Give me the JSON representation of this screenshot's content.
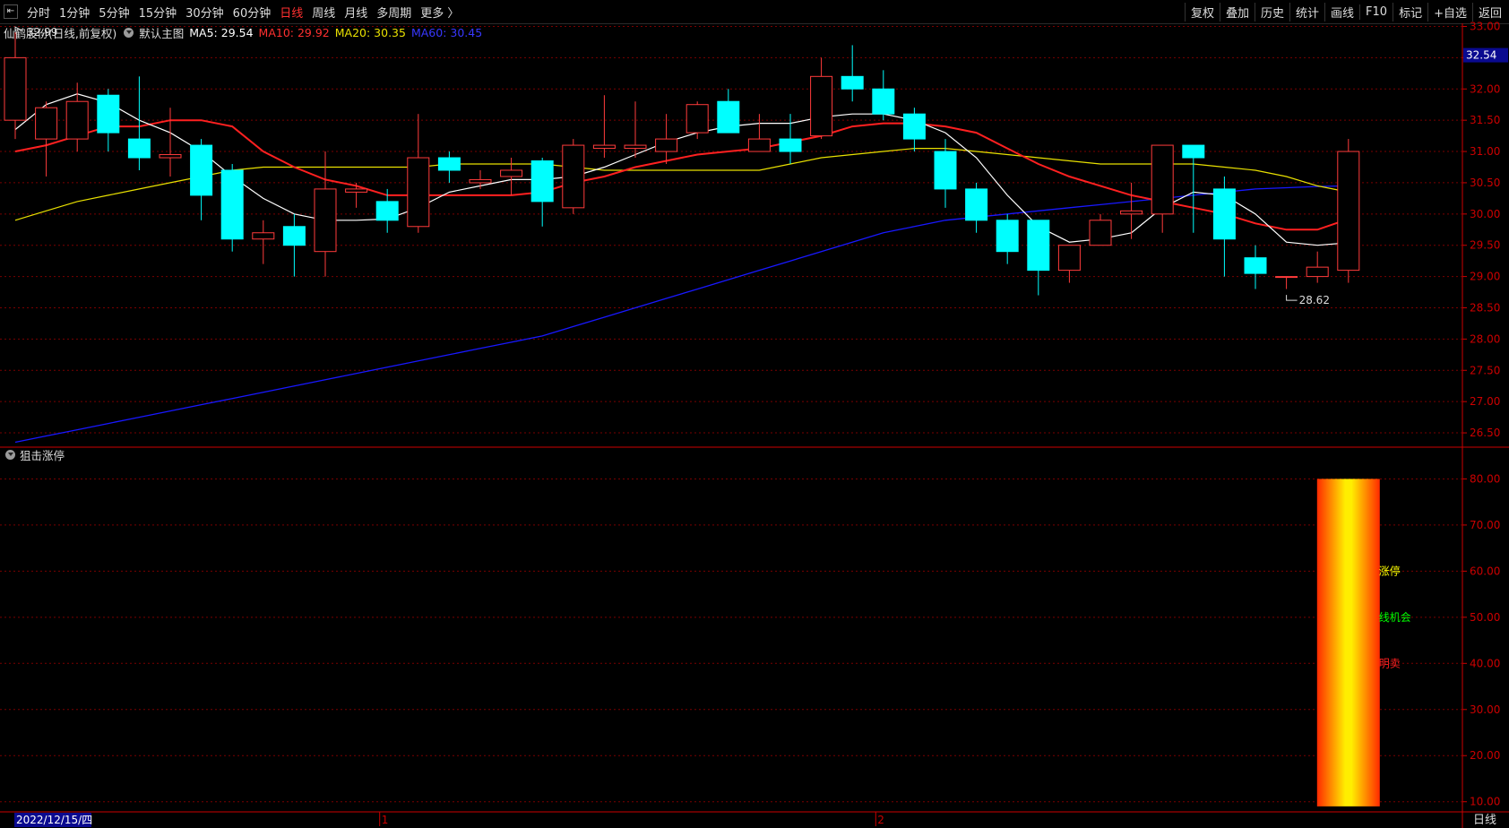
{
  "toolbar": {
    "periods": [
      "分时",
      "1分钟",
      "5分钟",
      "15分钟",
      "30分钟",
      "60分钟",
      "日线",
      "周线",
      "月线",
      "多周期",
      "更多"
    ],
    "active_period": "日线",
    "right_buttons": [
      "复权",
      "叠加",
      "历史",
      "统计",
      "画线",
      "F10",
      "标记",
      "+自选",
      "返回"
    ]
  },
  "main_legend": {
    "stock": "仙鹤股份",
    "mode": "(日线,前复权)",
    "template": "默认主图",
    "ma5_label": "MA5: 29.54",
    "ma10_label": "MA10: 29.92",
    "ma20_label": "MA20: 30.35",
    "ma60_label": "MA60: 30.45"
  },
  "indicator": {
    "name": "狙击涨停",
    "labels": [
      "涨停",
      "线机会",
      "明卖"
    ]
  },
  "colors": {
    "up": "#ff3b3b",
    "down": "#00ffff",
    "ma5": "#ffffff",
    "ma10": "#ff2020",
    "ma20": "#e8e000",
    "ma60": "#1818ff",
    "grid": "#7a0000",
    "axis": "#cc0000",
    "label_yellow": "#ffff00",
    "label_green": "#00ff00",
    "label_red": "#ff2020"
  },
  "chart_data": [
    {
      "type": "candlestick",
      "title": "仙鹤股份 (日线,前复权)",
      "y_ticks": [
        "33.00",
        "32.50",
        "32.00",
        "31.50",
        "31.00",
        "30.50",
        "30.00",
        "29.50",
        "29.00",
        "28.50",
        "28.00",
        "27.50",
        "27.00",
        "26.50"
      ],
      "ylim": [
        26.3,
        33.05
      ],
      "current_price": "32.54",
      "high_marker": "32.99",
      "low_marker": "28.62",
      "candles": [
        {
          "o": 31.5,
          "c": 32.5,
          "h": 33.0,
          "l": 31.2
        },
        {
          "o": 31.2,
          "c": 31.7,
          "h": 31.8,
          "l": 30.6
        },
        {
          "o": 31.2,
          "c": 31.8,
          "h": 32.1,
          "l": 31.0
        },
        {
          "o": 31.9,
          "c": 31.3,
          "h": 32.0,
          "l": 31.0
        },
        {
          "o": 31.2,
          "c": 30.9,
          "h": 32.2,
          "l": 30.7
        },
        {
          "o": 30.9,
          "c": 30.95,
          "h": 31.7,
          "l": 30.6
        },
        {
          "o": 31.1,
          "c": 30.3,
          "h": 31.2,
          "l": 29.9
        },
        {
          "o": 30.7,
          "c": 29.6,
          "h": 30.8,
          "l": 29.4
        },
        {
          "o": 29.6,
          "c": 29.7,
          "h": 29.9,
          "l": 29.2
        },
        {
          "o": 29.8,
          "c": 29.5,
          "h": 30.0,
          "l": 29.0
        },
        {
          "o": 29.4,
          "c": 30.4,
          "h": 31.0,
          "l": 29.0
        },
        {
          "o": 30.35,
          "c": 30.4,
          "h": 30.5,
          "l": 30.1
        },
        {
          "o": 30.2,
          "c": 29.9,
          "h": 30.4,
          "l": 29.7
        },
        {
          "o": 29.8,
          "c": 30.9,
          "h": 31.6,
          "l": 29.7
        },
        {
          "o": 30.9,
          "c": 30.7,
          "h": 31.0,
          "l": 30.5
        },
        {
          "o": 30.5,
          "c": 30.55,
          "h": 30.7,
          "l": 30.4
        },
        {
          "o": 30.6,
          "c": 30.7,
          "h": 30.9,
          "l": 30.3
        },
        {
          "o": 30.85,
          "c": 30.2,
          "h": 30.9,
          "l": 29.8
        },
        {
          "o": 30.1,
          "c": 31.1,
          "h": 31.2,
          "l": 30.0
        },
        {
          "o": 31.05,
          "c": 31.1,
          "h": 31.9,
          "l": 30.9
        },
        {
          "o": 31.05,
          "c": 31.1,
          "h": 31.8,
          "l": 30.9
        },
        {
          "o": 31.0,
          "c": 31.2,
          "h": 31.6,
          "l": 30.8
        },
        {
          "o": 31.3,
          "c": 31.75,
          "h": 31.8,
          "l": 31.2
        },
        {
          "o": 31.8,
          "c": 31.3,
          "h": 32.0,
          "l": 31.3
        },
        {
          "o": 31.0,
          "c": 31.2,
          "h": 31.6,
          "l": 31.0
        },
        {
          "o": 31.2,
          "c": 31.0,
          "h": 31.6,
          "l": 30.8
        },
        {
          "o": 31.25,
          "c": 32.2,
          "h": 32.5,
          "l": 31.2
        },
        {
          "o": 32.2,
          "c": 32.0,
          "h": 32.7,
          "l": 31.8
        },
        {
          "o": 32.0,
          "c": 31.6,
          "h": 32.3,
          "l": 31.5
        },
        {
          "o": 31.6,
          "c": 31.2,
          "h": 31.7,
          "l": 31.0
        },
        {
          "o": 31.0,
          "c": 30.4,
          "h": 31.2,
          "l": 30.1
        },
        {
          "o": 30.4,
          "c": 29.9,
          "h": 30.5,
          "l": 29.7
        },
        {
          "o": 29.9,
          "c": 29.4,
          "h": 30.0,
          "l": 29.2
        },
        {
          "o": 29.9,
          "c": 29.1,
          "h": 29.9,
          "l": 28.7
        },
        {
          "o": 29.1,
          "c": 29.5,
          "h": 29.5,
          "l": 28.9
        },
        {
          "o": 29.5,
          "c": 29.9,
          "h": 30.0,
          "l": 29.5
        },
        {
          "o": 30.0,
          "c": 30.05,
          "h": 30.5,
          "l": 29.6
        },
        {
          "o": 30.0,
          "c": 31.1,
          "h": 31.1,
          "l": 29.7
        },
        {
          "o": 31.1,
          "c": 30.9,
          "h": 31.1,
          "l": 29.7
        },
        {
          "o": 30.4,
          "c": 29.6,
          "h": 30.6,
          "l": 29.0
        },
        {
          "o": 29.3,
          "c": 29.05,
          "h": 29.5,
          "l": 28.8
        },
        {
          "o": 29.0,
          "c": 29.0,
          "h": 29.0,
          "l": 28.8
        },
        {
          "o": 29.0,
          "c": 29.15,
          "h": 29.4,
          "l": 28.9
        },
        {
          "o": 29.1,
          "c": 31.0,
          "h": 31.2,
          "l": 28.9
        }
      ],
      "ma5": [
        31.35,
        31.75,
        31.92,
        31.78,
        31.5,
        31.3,
        31.0,
        30.6,
        30.25,
        30.0,
        29.9,
        29.9,
        29.92,
        30.1,
        30.35,
        30.45,
        30.55,
        30.55,
        30.6,
        30.75,
        30.95,
        31.15,
        31.3,
        31.4,
        31.45,
        31.45,
        31.55,
        31.6,
        31.6,
        31.5,
        31.3,
        30.9,
        30.3,
        29.8,
        29.55,
        29.6,
        29.7,
        30.1,
        30.35,
        30.3,
        30.0,
        29.55,
        29.5,
        29.54
      ],
      "ma10": [
        31.0,
        31.1,
        31.25,
        31.4,
        31.4,
        31.5,
        31.5,
        31.4,
        31.0,
        30.75,
        30.55,
        30.45,
        30.3,
        30.3,
        30.3,
        30.3,
        30.3,
        30.35,
        30.5,
        30.6,
        30.75,
        30.85,
        30.95,
        31.0,
        31.05,
        31.15,
        31.25,
        31.4,
        31.45,
        31.45,
        31.4,
        31.3,
        31.05,
        30.8,
        30.6,
        30.45,
        30.3,
        30.2,
        30.1,
        30.0,
        29.85,
        29.75,
        29.75,
        29.92
      ],
      "ma20": [
        29.9,
        30.05,
        30.2,
        30.3,
        30.4,
        30.5,
        30.6,
        30.7,
        30.75,
        30.75,
        30.75,
        30.75,
        30.75,
        30.75,
        30.8,
        30.8,
        30.8,
        30.8,
        30.75,
        30.7,
        30.7,
        30.7,
        30.7,
        30.7,
        30.7,
        30.8,
        30.9,
        30.95,
        31.0,
        31.05,
        31.05,
        31.0,
        30.95,
        30.9,
        30.85,
        30.8,
        30.8,
        30.8,
        30.8,
        30.75,
        30.7,
        30.6,
        30.45,
        30.35
      ],
      "ma60": [
        26.35,
        26.45,
        26.55,
        26.65,
        26.75,
        26.85,
        26.95,
        27.05,
        27.15,
        27.25,
        27.35,
        27.45,
        27.55,
        27.65,
        27.75,
        27.85,
        27.95,
        28.05,
        28.2,
        28.35,
        28.5,
        28.65,
        28.8,
        28.95,
        29.1,
        29.25,
        29.4,
        29.55,
        29.7,
        29.8,
        29.9,
        29.95,
        30.0,
        30.05,
        30.1,
        30.15,
        30.2,
        30.25,
        30.3,
        30.35,
        30.4,
        30.42,
        30.44,
        30.45
      ]
    },
    {
      "type": "bar",
      "title": "狙击涨停",
      "y_ticks": [
        "80.00",
        "70.00",
        "60.00",
        "50.00",
        "40.00",
        "30.00",
        "20.00",
        "10.00"
      ],
      "ylim": [
        8,
        83
      ],
      "gradient_bar": {
        "index": 43,
        "low": 9,
        "high": 80
      }
    }
  ],
  "x_axis": {
    "date_label": "2022/12/15/四",
    "month_marks": [
      {
        "label": "1",
        "index": 12
      },
      {
        "label": "2",
        "index": 28
      }
    ],
    "period_label": "日线"
  }
}
